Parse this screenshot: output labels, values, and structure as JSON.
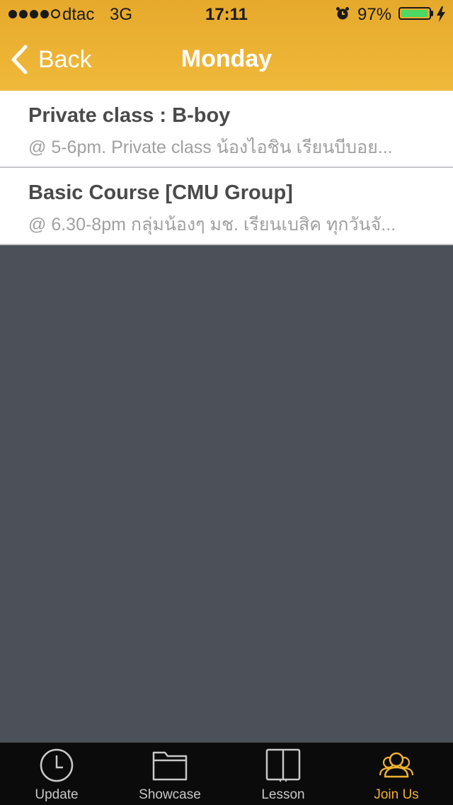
{
  "status_bar": {
    "carrier": "dtac",
    "network": "3G",
    "time": "17:11",
    "battery": "97%",
    "battery_level": 0.97,
    "signal_bars": 4,
    "icons": [
      "signal-dots-icon",
      "alarm-icon",
      "battery-icon",
      "charging-bolt-icon"
    ]
  },
  "nav": {
    "back_label": "Back",
    "title": "Monday"
  },
  "list": {
    "items": [
      {
        "title": "Private class : B-boy",
        "subtitle": "@ 5-6pm. Private class น้องไอชิน เรียนบีบอย..."
      },
      {
        "title": "Basic Course [CMU Group]",
        "subtitle": "@ 6.30-8pm กลุ่มน้องๆ มช. เรียนเบสิค ทุกวันจั..."
      }
    ]
  },
  "tabs": [
    {
      "label": "Update",
      "icon": "clock-icon",
      "active": false
    },
    {
      "label": "Showcase",
      "icon": "folder-icon",
      "active": false
    },
    {
      "label": "Lesson",
      "icon": "book-icon",
      "active": false
    },
    {
      "label": "Join Us",
      "icon": "people-icon",
      "active": true
    }
  ],
  "colors": {
    "header": "#eeb133",
    "accent": "#f0b22f",
    "background": "#4c5058",
    "tab_bar": "#0b0b0b"
  }
}
